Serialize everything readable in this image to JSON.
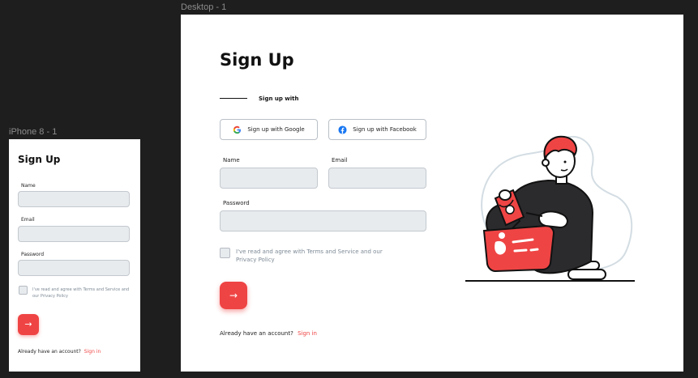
{
  "frames": {
    "desktop_label": "Desktop - 1",
    "iphone_label": "iPhone 8 - 1"
  },
  "colors": {
    "accent": "#ef4444",
    "input_bg": "#e8ebee",
    "canvas": "#1e1e1e"
  },
  "mobile": {
    "title": "Sign Up",
    "name_label": "Name",
    "email_label": "Email",
    "password_label": "Password",
    "agree_text": "I've read and agree with Terms and Service and our Privacy Policy",
    "submit_icon": "→",
    "already_text": "Already have an account?",
    "signin_link": "Sign in"
  },
  "desktop": {
    "title": "Sign Up",
    "signup_with": "Sign up with",
    "google_button": "Sign up with Google",
    "facebook_button": "Sign up with Facebook",
    "name_label": "Name",
    "email_label": "Email",
    "password_label": "Password",
    "agree_text": "I've read and agree with Terms and Service and our Privacy Policy",
    "submit_icon": "→",
    "already_text": "Already have an account?",
    "signin_link": "Sign in"
  }
}
